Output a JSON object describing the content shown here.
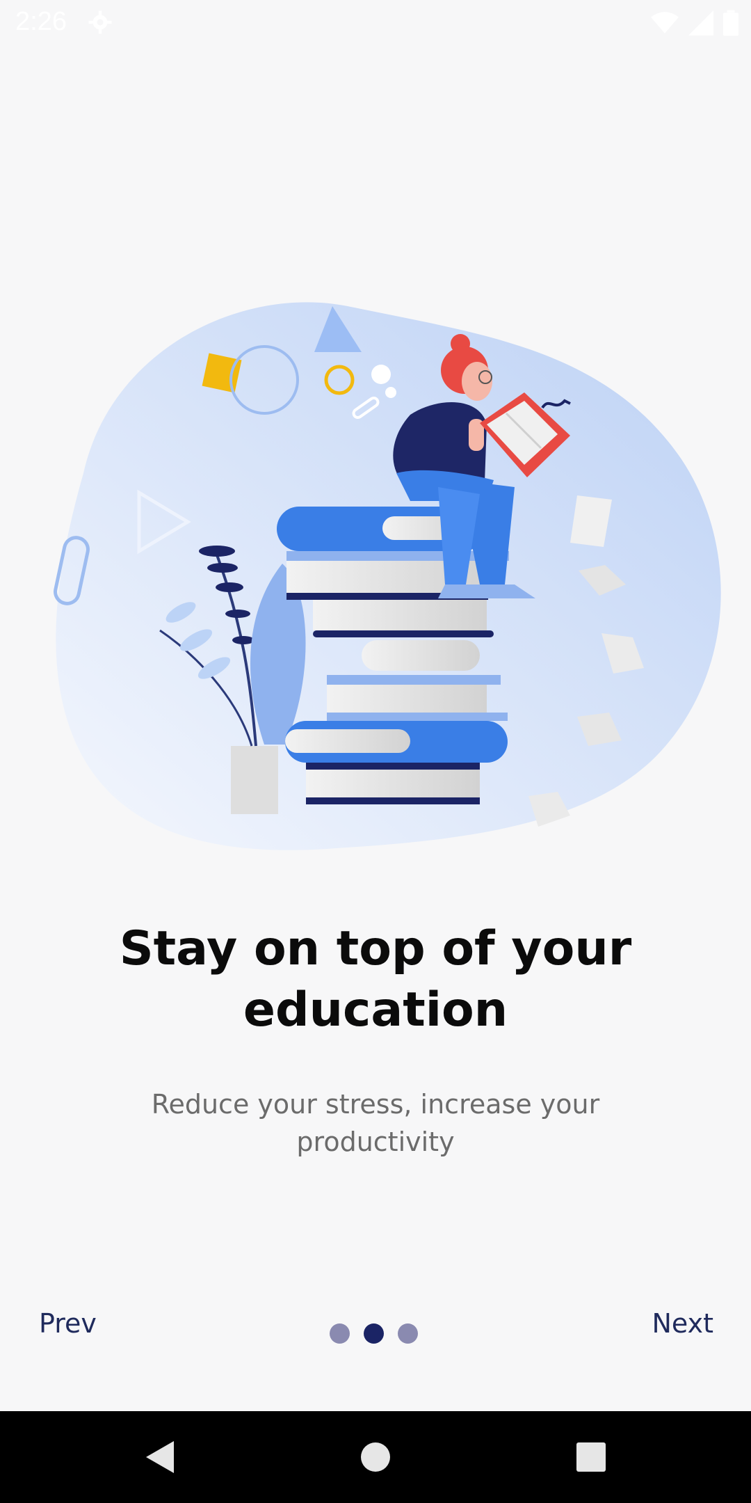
{
  "status_bar": {
    "time": "2:26",
    "icons": [
      "gear-icon",
      "wifi-icon",
      "signal-icon",
      "battery-icon"
    ]
  },
  "onboarding": {
    "illustration": "woman-reading-on-books-illustration",
    "title": "Stay on top of your education",
    "subtitle": "Reduce your stress, increase your productivity"
  },
  "pager": {
    "prev_label": "Prev",
    "next_label": "Next",
    "page_count": 3,
    "active_page": 2
  },
  "system_nav": {
    "icons": [
      "back-icon",
      "home-icon",
      "recents-icon"
    ]
  },
  "colors": {
    "background": "#f7f7f8",
    "accent": "#1b2465",
    "blob": "#c9d9f7",
    "book_blue": "#3a7ee6"
  }
}
